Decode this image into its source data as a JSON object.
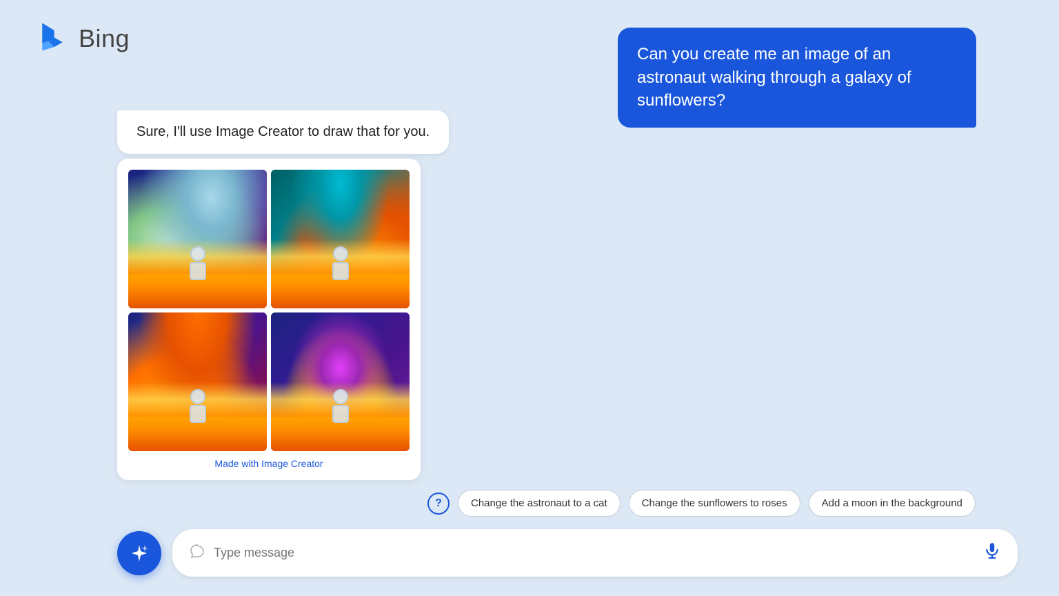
{
  "header": {
    "logo_alt": "Bing logo",
    "title": "Bing"
  },
  "user_message": {
    "text": "Can you create me an image of an astronaut walking through a galaxy of sunflowers?"
  },
  "assistant_message": {
    "text": "Sure, I'll use Image Creator to draw that for you."
  },
  "image_grid": {
    "made_with_label": "Made with ",
    "made_with_link": "Image Creator"
  },
  "suggestions": {
    "help_icon": "?",
    "chips": [
      {
        "label": "Change the astronaut to a cat"
      },
      {
        "label": "Change the sunflowers to roses"
      },
      {
        "label": "Add a moon in the background"
      }
    ]
  },
  "input": {
    "placeholder": "Type message"
  },
  "colors": {
    "user_bubble_bg": "#1a56db",
    "page_bg": "#dce8f5",
    "bing_button_bg": "#1a56db"
  }
}
